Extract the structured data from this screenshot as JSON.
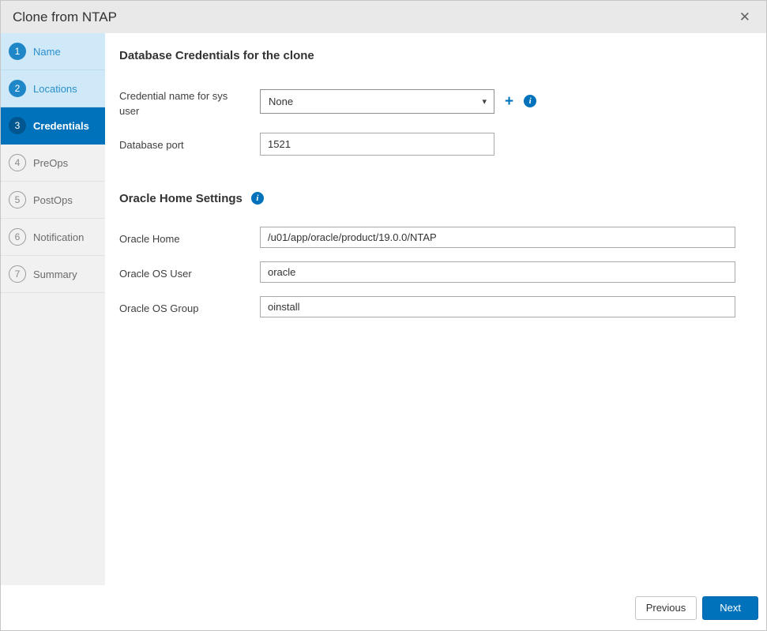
{
  "window": {
    "title": "Clone from NTAP"
  },
  "icons": {
    "close": "✕",
    "caret": "▾",
    "plus": "+",
    "info": "i"
  },
  "steps": [
    {
      "number": "1",
      "label": "Name",
      "state": "completed"
    },
    {
      "number": "2",
      "label": "Locations",
      "state": "completed"
    },
    {
      "number": "3",
      "label": "Credentials",
      "state": "active"
    },
    {
      "number": "4",
      "label": "PreOps",
      "state": "pending"
    },
    {
      "number": "5",
      "label": "PostOps",
      "state": "pending"
    },
    {
      "number": "6",
      "label": "Notification",
      "state": "pending"
    },
    {
      "number": "7",
      "label": "Summary",
      "state": "pending"
    }
  ],
  "credentials_section": {
    "title": "Database Credentials for the clone",
    "credential_name": {
      "label": "Credential name for sys user",
      "value": "None"
    },
    "database_port": {
      "label": "Database port",
      "value": "1521"
    }
  },
  "oracle_section": {
    "title": "Oracle Home Settings",
    "oracle_home": {
      "label": "Oracle Home",
      "value": "/u01/app/oracle/product/19.0.0/NTAP"
    },
    "oracle_os_user": {
      "label": "Oracle OS User",
      "value": "oracle"
    },
    "oracle_os_group": {
      "label": "Oracle OS Group",
      "value": "oinstall"
    }
  },
  "footer": {
    "previous": "Previous",
    "next": "Next"
  },
  "colors": {
    "accent": "#0072bc",
    "active_step_bg": "#0072bc",
    "completed_step_bg": "#cfe9f8",
    "titlebar_bg": "#e9e9e9",
    "sidebar_bg": "#f1f1f1"
  }
}
